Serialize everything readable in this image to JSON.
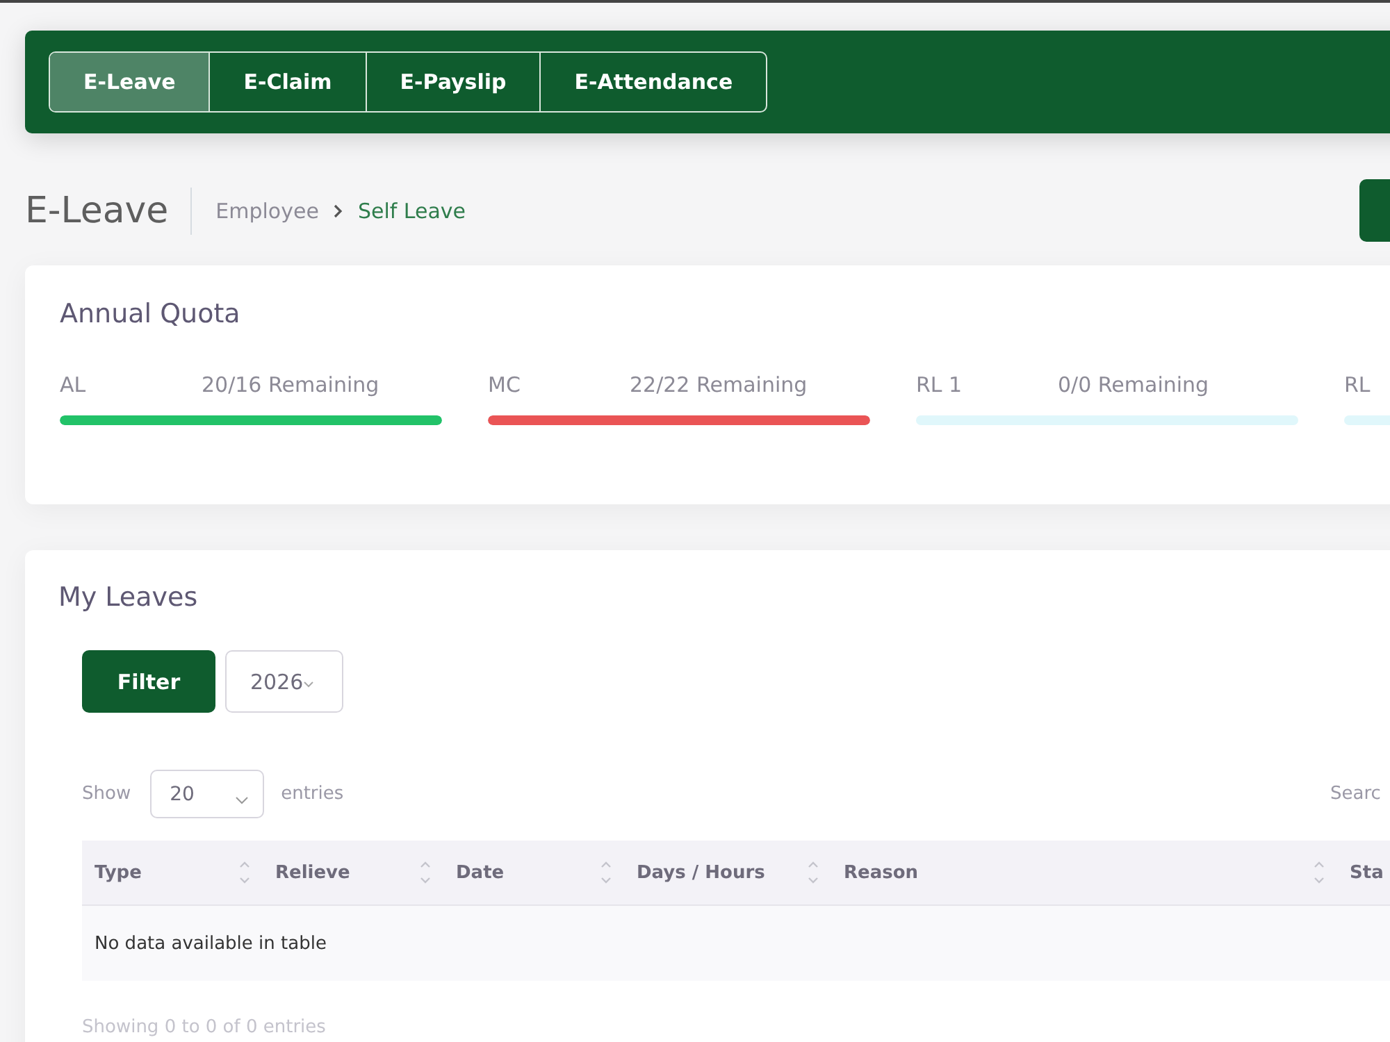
{
  "nav_tabs": [
    {
      "label": "E-Leave",
      "selected": true
    },
    {
      "label": "E-Claim",
      "selected": false
    },
    {
      "label": "E-Payslip",
      "selected": false
    },
    {
      "label": "E-Attendance",
      "selected": false
    }
  ],
  "page_title": "E-Leave",
  "breadcrumb": [
    {
      "label": "Employee",
      "current": false
    },
    {
      "label": "Self Leave",
      "current": true
    }
  ],
  "annual_quota": {
    "title": "Annual Quota",
    "items": [
      {
        "code": "AL",
        "remaining": "20/16 Remaining",
        "level": 1,
        "color": "#22c268"
      },
      {
        "code": "MC",
        "remaining": "22/22 Remaining",
        "level": 1,
        "color": "#ea5455"
      },
      {
        "code": "RL 1",
        "remaining": "0/0 Remaining"
      },
      {
        "code": "RL"
      }
    ]
  },
  "my_leaves": {
    "title": "My Leaves",
    "filter_button": "Filter",
    "year": "2026",
    "show_label": "Show",
    "page_size": "20",
    "entries_label": "entries",
    "search_label": "Searc",
    "table": {
      "columns": [
        "Type",
        "Relieve",
        "Date",
        "Days / Hours",
        "Reason",
        "Sta"
      ],
      "empty_message": "No data available in table"
    },
    "footer": "Showing 0 to 0 of 0 entries"
  }
}
